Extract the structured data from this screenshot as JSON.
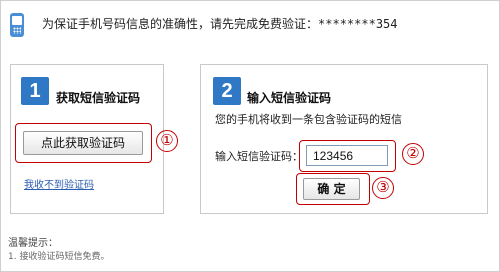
{
  "header": {
    "icon": "mobile-phone-icon",
    "text": "为保证手机号码信息的准确性，请先完成免费验证：",
    "masked_number": "********354"
  },
  "step1": {
    "number": "1",
    "title": "获取短信验证码",
    "button_label": "点此获取验证码",
    "annotation": "①",
    "link_text": "我收不到验证码"
  },
  "step2": {
    "number": "2",
    "title": "输入短信验证码",
    "description": "您的手机将收到一条包含验证码的短信",
    "input_label": "输入短信验证码：",
    "input_value": "123456",
    "input_annotation": "②",
    "confirm_label": "确 定",
    "confirm_annotation": "③"
  },
  "tips": {
    "title": "温馨提示：",
    "items": [
      "1. 接收验证码短信免费。"
    ]
  },
  "colors": {
    "accent": "#2f78c6",
    "arrow": "#5aa0e6",
    "annotation": "#c40000",
    "link": "#2a5db0"
  }
}
